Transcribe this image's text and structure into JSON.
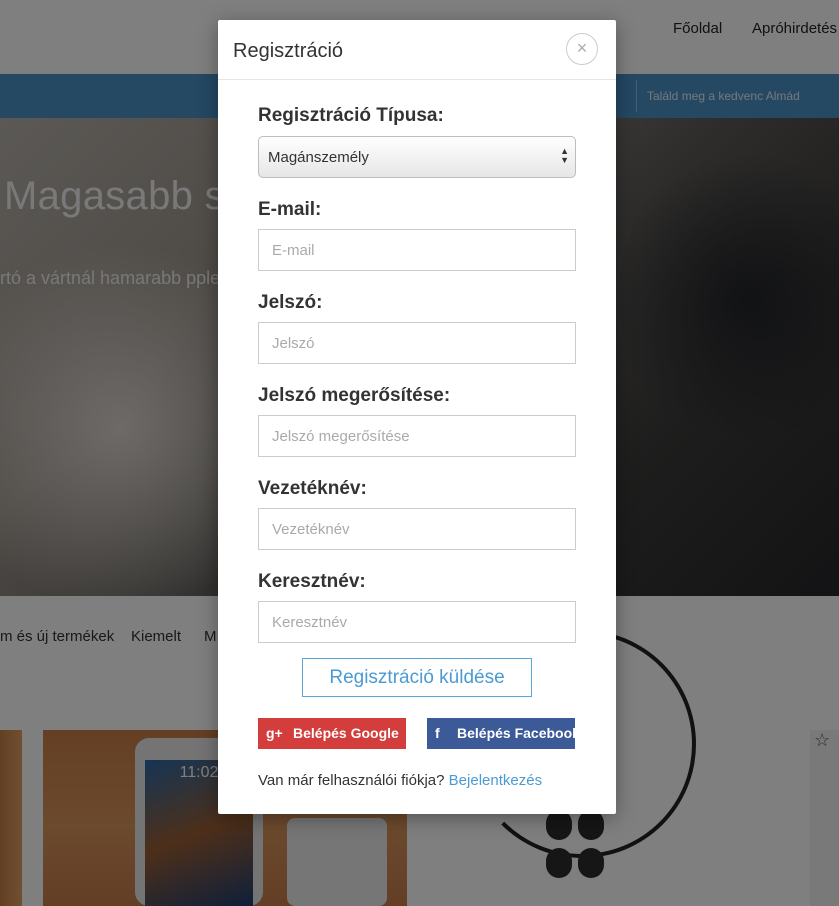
{
  "background": {
    "nav": {
      "home": "Főoldal",
      "classifieds": "Apróhirdetés"
    },
    "search_placeholder": "Találd meg a kedvenc Almád",
    "hero": {
      "title": "Magasabb se                                    csol az Intel",
      "subtitle": "rtó a vártnál hamarabb                                              pple masináiban is találko"
    },
    "categories": [
      "m és új termékek",
      "Kiemelt",
      "M"
    ],
    "phone_time": "11:02",
    "star_icon": "star-icon"
  },
  "modal": {
    "title": "Regisztráció",
    "close_icon": "close-icon",
    "type_label": "Regisztráció Típusa:",
    "type_value": "Magánszemély",
    "email_label": "E-mail:",
    "email_placeholder": "E-mail",
    "password_label": "Jelszó:",
    "password_placeholder": "Jelszó",
    "password_confirm_label": "Jelszó megerősítése:",
    "password_confirm_placeholder": "Jelszó megerősítése",
    "lastname_label": "Vezetéknév:",
    "lastname_placeholder": "Vezetéknév",
    "firstname_label": "Keresztnév:",
    "firstname_placeholder": "Keresztnév",
    "submit_label": "Regisztráció küldése",
    "google_icon": "g+",
    "google_label": "Belépés Google",
    "facebook_icon": "f",
    "facebook_label": "Belépés Facebook",
    "login_prompt": "Van már felhasználói fiókja?",
    "login_link": "Bejelentkezés"
  },
  "colors": {
    "accent": "#4a9bd3",
    "google": "#d33d3b",
    "facebook": "#3c5a98",
    "header_bar": "#4a90c7"
  }
}
